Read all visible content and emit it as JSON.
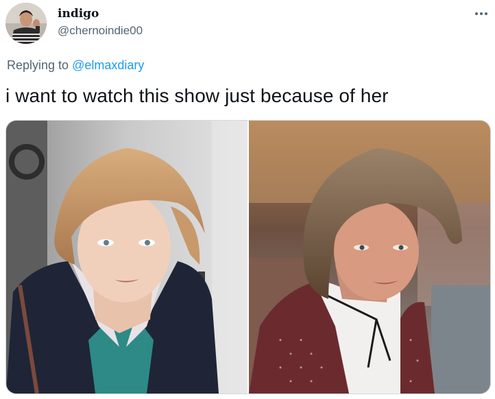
{
  "user": {
    "display_name": "indigo",
    "handle": "@chernoindie00",
    "avatar_icon": "profile-photo-avatar"
  },
  "reply": {
    "prefix": "Replying to ",
    "mention": "@elmaxdiary"
  },
  "tweet": {
    "text": "i want to watch this show just because of her"
  },
  "media": {
    "left_photo": "photo-of-woman-with-short-blonde-hair-in-navy-coat",
    "right_photo": "photo-of-woman-with-short-hair-in-maroon-cardigan"
  },
  "colors": {
    "text": "#0f1419",
    "secondary": "#536471",
    "link": "#1d9bf0"
  },
  "icons": {
    "more": "more-options-icon"
  }
}
